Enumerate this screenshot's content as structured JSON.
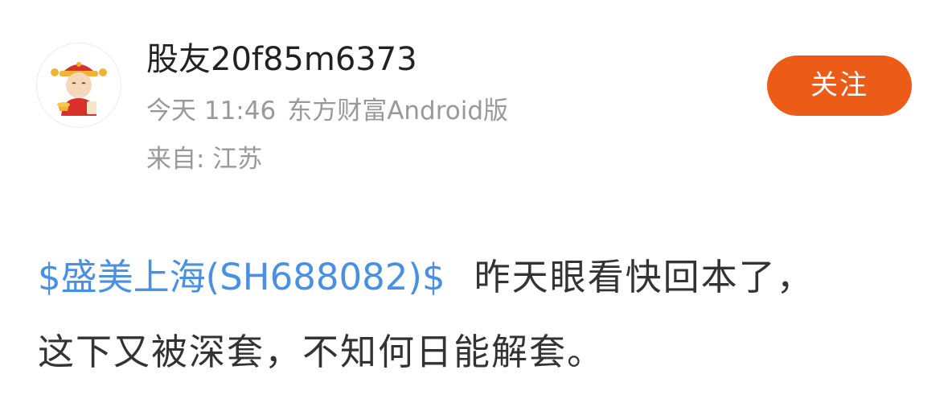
{
  "post": {
    "author": {
      "username": "股友20f85m6373",
      "avatar_icon": "caishen-avatar-icon"
    },
    "meta": {
      "time": "今天 11:46",
      "client": "东方财富Android版",
      "location": "来自: 江苏"
    },
    "follow_label": "关注",
    "content": {
      "stock_tag": "$盛美上海(SH688082)$",
      "text": "昨天眼看快回本了，这下又被深套，不知何日能解套。"
    }
  },
  "colors": {
    "accent": "#ec5b17",
    "link": "#4a90e2",
    "meta_text": "#999999",
    "body_text": "#333333"
  }
}
